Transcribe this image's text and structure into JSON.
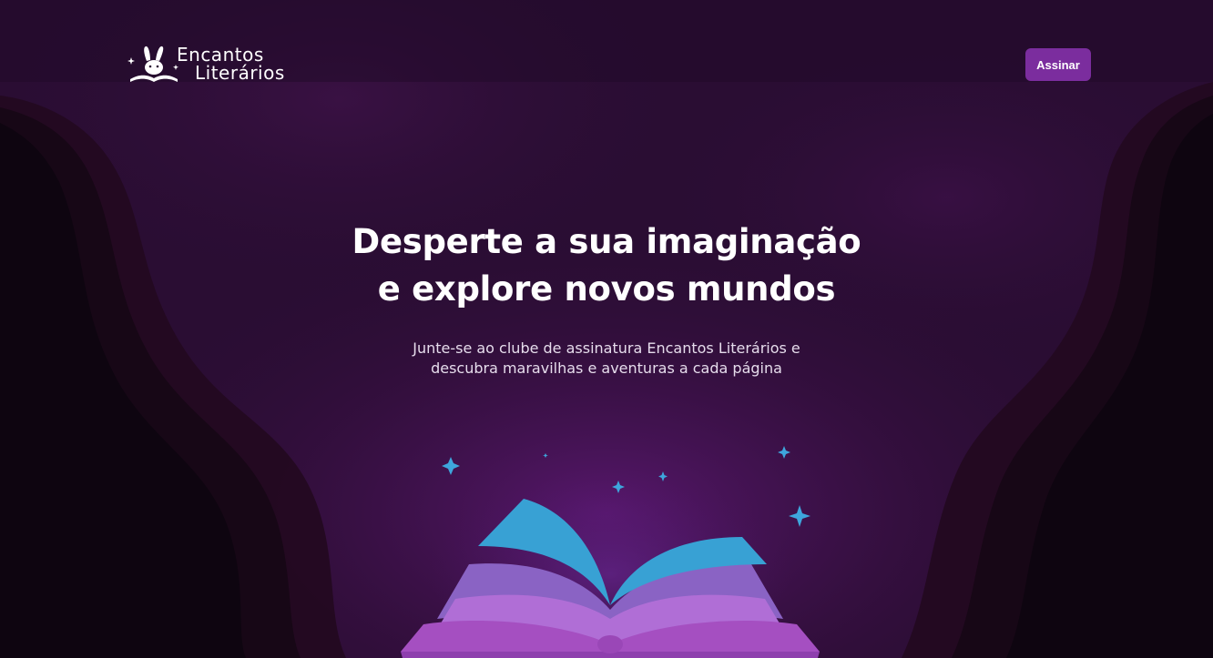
{
  "brand": {
    "name_line1": "Encantos",
    "name_line2": "Literários"
  },
  "header": {
    "subscribe_label": "Assinar"
  },
  "hero": {
    "title_line1": "Desperte a sua imaginação",
    "title_line2": "e explore novos mundos",
    "subtitle_line1": "Junte-se ao clube de assinatura Encantos Literários e",
    "subtitle_line2": "descubra maravilhas e aventuras a cada página"
  },
  "icons": {
    "logo": "rabbit-on-book-icon",
    "hero_illustration": "open-book-icon",
    "decor": "sparkle-icon"
  },
  "colors": {
    "background_dark": "#0d0713",
    "background_purple": "#2a0d33",
    "accent_button": "#7b2d9e",
    "book_pages_blue": "#38a1d4",
    "book_cover_purple": "#a54fc1",
    "sparkle_blue": "#3ea6dc"
  }
}
